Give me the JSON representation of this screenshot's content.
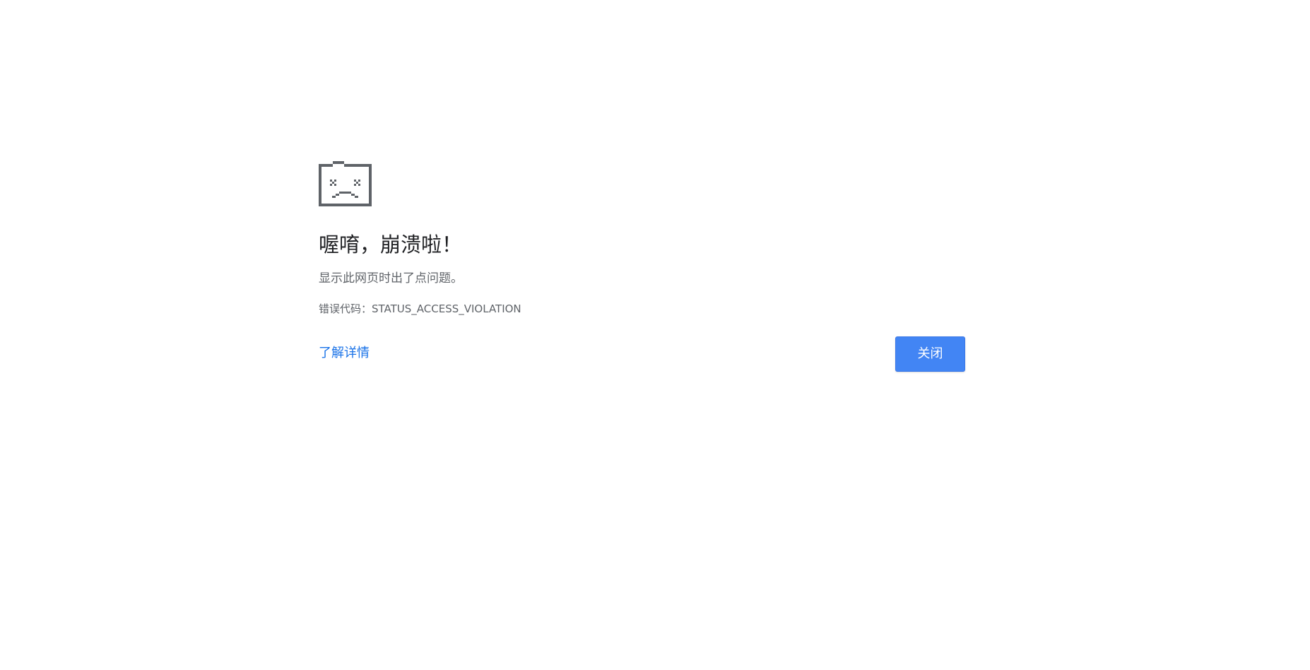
{
  "icon": "sad-tab-icon",
  "title": "喔唷，崩溃啦！",
  "message": "显示此网页时出了点问题。",
  "error_code_text": "错误代码：STATUS_ACCESS_VIOLATION",
  "learn_more_label": "了解详情",
  "close_label": "关闭",
  "colors": {
    "icon": "#5f6368",
    "title": "#202124",
    "body_text": "#5f6368",
    "link": "#1a73e8",
    "button_bg": "#4285f4",
    "button_text": "#ffffff"
  }
}
